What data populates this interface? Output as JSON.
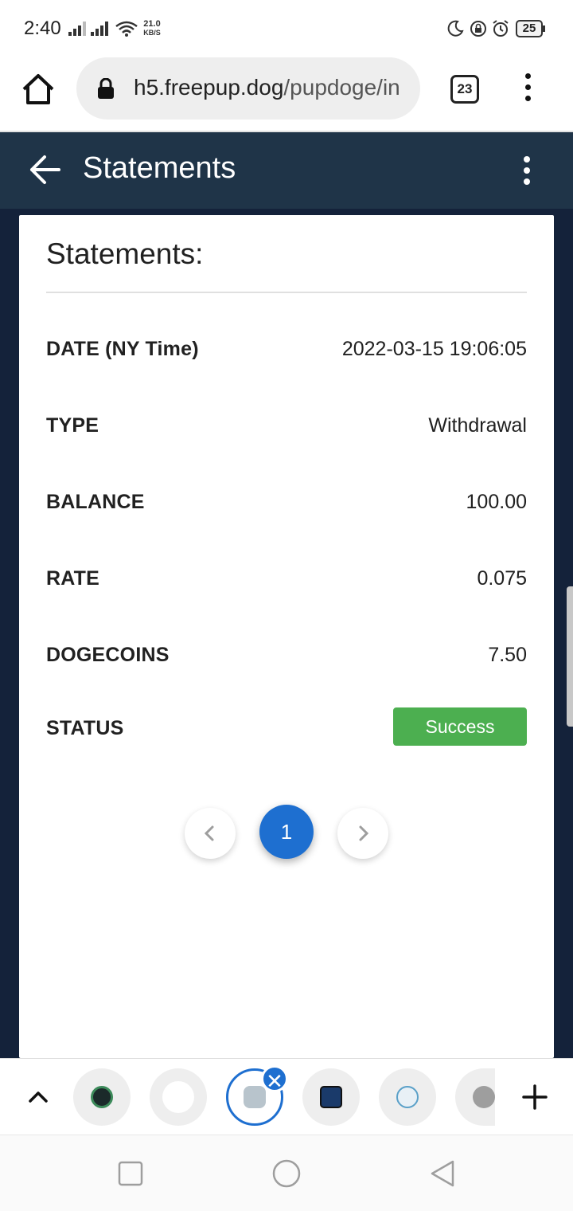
{
  "status_bar": {
    "time": "2:40",
    "net_speed_value": "21.0",
    "net_speed_unit": "KB/S",
    "battery": "25"
  },
  "browser": {
    "url_domain": "h5.freepup.dog",
    "url_path": "/pupdoge/in",
    "tab_count": "23"
  },
  "header": {
    "title": "Statements"
  },
  "statement": {
    "heading": "Statements:",
    "rows": [
      {
        "label": "DATE (NY Time)",
        "value": "2022-03-15 19:06:05"
      },
      {
        "label": "TYPE",
        "value": "Withdrawal"
      },
      {
        "label": "BALANCE",
        "value": "100.00"
      },
      {
        "label": "RATE",
        "value": "0.075"
      },
      {
        "label": "DOGECOINS",
        "value": "7.50"
      },
      {
        "label": "STATUS",
        "value": "Success"
      }
    ]
  },
  "pagination": {
    "current_page": "1"
  },
  "tab_strip": {
    "close_symbol": "✕"
  },
  "colors": {
    "header_bg": "#1f3448",
    "page_bg": "#14223a",
    "success": "#4caf50",
    "accent": "#1e6fd0"
  }
}
